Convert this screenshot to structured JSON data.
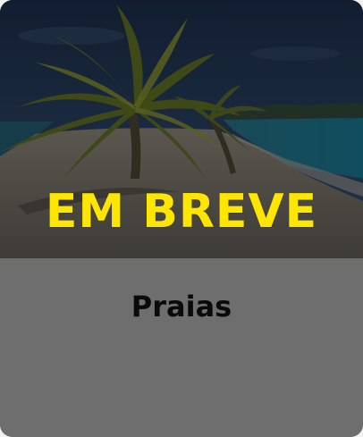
{
  "card": {
    "status_text": "EM BREVE",
    "category_label": "Praias",
    "accent_color": "#ffe600"
  },
  "hero_image": {
    "icon": "beach-palm-image"
  }
}
